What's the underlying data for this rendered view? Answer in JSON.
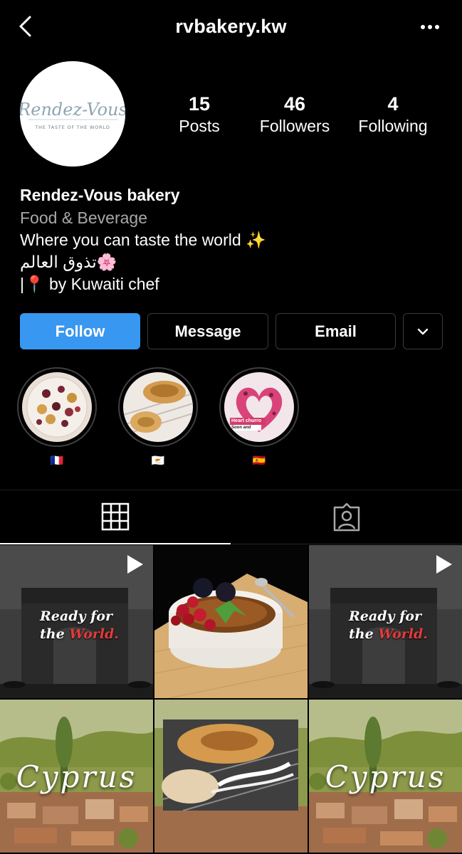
{
  "header": {
    "username": "rvbakery.kw",
    "back_icon": "chevron-left-icon",
    "more_icon": "more-horizontal-icon"
  },
  "avatar": {
    "logo_text": "Rendez-Vous",
    "logo_tagline": "THE TASTE OF THE WORLD"
  },
  "stats": [
    {
      "value": "15",
      "label": "Posts"
    },
    {
      "value": "46",
      "label": "Followers"
    },
    {
      "value": "4",
      "label": "Following"
    }
  ],
  "bio": {
    "name": "Rendez-Vous bakery",
    "category": "Food & Beverage",
    "line1": "Where you can taste the world ✨",
    "line2": "تذوق العالم🌸",
    "line3": "|📍 by Kuwaiti chef"
  },
  "actions": {
    "follow": "Follow",
    "message": "Message",
    "email": "Email"
  },
  "highlights": [
    {
      "label": "🇫🇷"
    },
    {
      "label": "🇨🇾"
    },
    {
      "label": "🇪🇸",
      "overlay_text": "Heart churro",
      "overlay_sub": "Soon and"
    }
  ],
  "tabs": {
    "grid_icon": "grid-icon",
    "tagged_icon": "tagged-person-icon"
  },
  "posts": [
    {
      "type": "video",
      "line1": "Ready for",
      "line2_a": "the ",
      "line2_b": "World."
    },
    {
      "type": "photo"
    },
    {
      "type": "video",
      "line1": "Ready for",
      "line2_a": "the ",
      "line2_b": "World."
    },
    {
      "type": "photo",
      "text": "Cyprus"
    },
    {
      "type": "photo"
    },
    {
      "type": "photo",
      "text": "Cyprus"
    }
  ],
  "colors": {
    "accent": "#3897f0",
    "background": "#000000",
    "secondary_text": "#a8a8a8",
    "highlight_red": "#e23b3b"
  }
}
